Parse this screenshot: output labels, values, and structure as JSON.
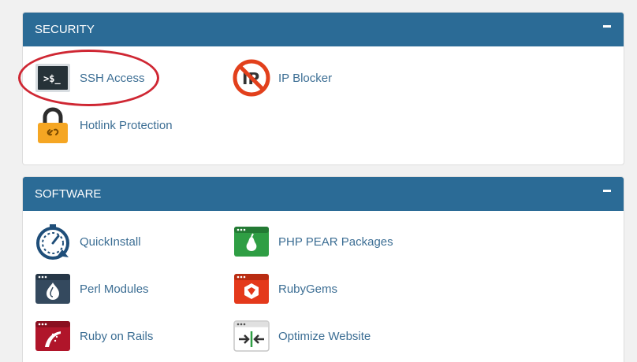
{
  "security": {
    "title": "SECURITY",
    "items": [
      {
        "label": "SSH Access",
        "icon": "terminal-icon"
      },
      {
        "label": "IP Blocker",
        "icon": "ip-blocker-icon"
      },
      {
        "label": "Hotlink Protection",
        "icon": "padlock-icon"
      }
    ]
  },
  "software": {
    "title": "SOFTWARE",
    "items": [
      {
        "label": "QuickInstall",
        "icon": "stopwatch-icon"
      },
      {
        "label": "PHP PEAR Packages",
        "icon": "php-pear-icon"
      },
      {
        "label": "Perl Modules",
        "icon": "perl-onion-icon"
      },
      {
        "label": "RubyGems",
        "icon": "ruby-gem-icon"
      },
      {
        "label": "Ruby on Rails",
        "icon": "ruby-rails-icon"
      },
      {
        "label": "Optimize Website",
        "icon": "optimize-arrows-icon"
      }
    ]
  },
  "terminal_prompt": ">$_",
  "ip_text": "IP",
  "colors": {
    "header": "#2b6b96",
    "link": "#3c6e94",
    "highlight": "#cf2733"
  }
}
